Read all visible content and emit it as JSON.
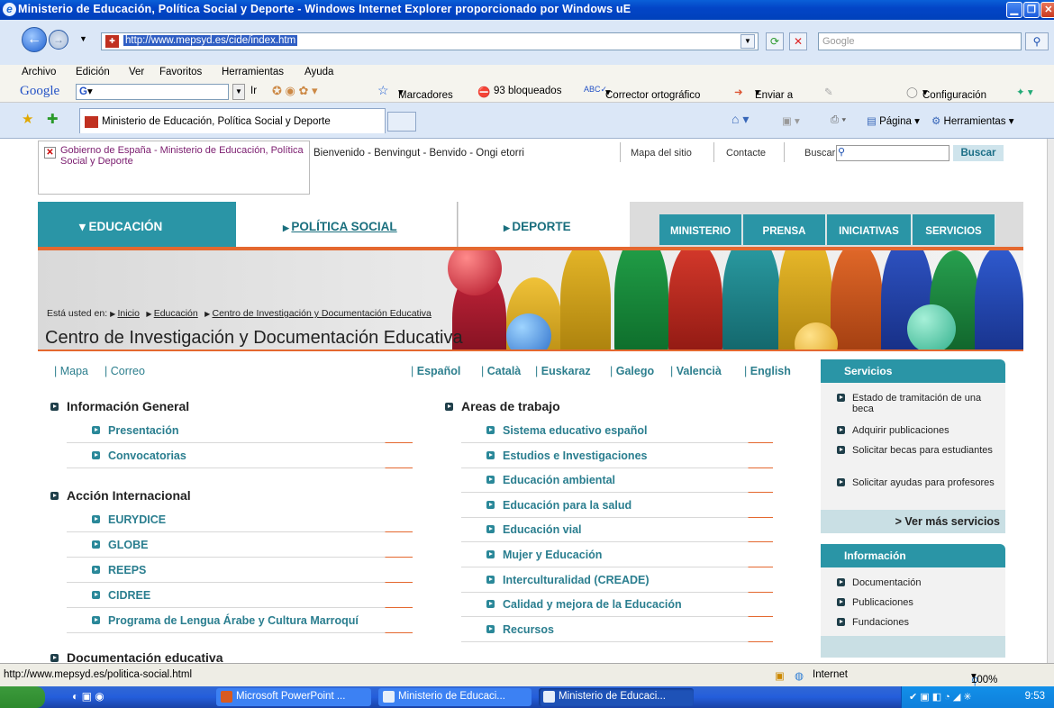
{
  "window": {
    "title": "Ministerio de Educación, Política Social y Deporte - Windows Internet Explorer proporcionado por Windows uE"
  },
  "addressbar": {
    "url": "http://www.mepsyd.es/cide/index.htm",
    "search_placeholder": "Google"
  },
  "menubar": [
    "Archivo",
    "Edición",
    "Ver",
    "Favoritos",
    "Herramientas",
    "Ayuda"
  ],
  "google_toolbar": {
    "brand": "Google",
    "g_field": "G",
    "ir": "Ir",
    "marcadores": "Marcadores",
    "bloqueados": "93 bloqueados",
    "corrector": "Corrector ortográfico",
    "enviar": "Enviar a",
    "configuracion": "Configuración"
  },
  "tabs": {
    "active_tab": "Ministerio de Educación, Política Social y Deporte",
    "pagina": "Página",
    "herramientas": "Herramientas"
  },
  "page": {
    "gov_logo_text": "Gobierno de España - Ministerio de Educación, Política Social y Deporte",
    "welcome": "Bienvenido - Benvingut - Benvido - Ongi etorri",
    "mapa_sitio": "Mapa del sitio",
    "contacte": "Contacte",
    "buscar_label": "Buscar:",
    "buscar_button": "Buscar",
    "nav_main": [
      "EDUCACIÓN",
      "POLÍTICA SOCIAL",
      "DEPORTE"
    ],
    "nav_small": [
      "MINISTERIO",
      "PRENSA",
      "INICIATIVAS",
      "SERVICIOS"
    ],
    "breadcrumb": {
      "prefix": "Está usted en:",
      "items": [
        "Inicio",
        "Educación",
        "Centro de Investigación y Documentación Educativa"
      ]
    },
    "title": "Centro de Investigación y Documentación Educativa",
    "left_links": [
      "Mapa",
      "Correo"
    ],
    "languages": [
      "Español",
      "Català",
      "Euskaraz",
      "Galego",
      "Valencià",
      "English"
    ],
    "info_general": {
      "heading": "Información General",
      "items": [
        "Presentación",
        "Convocatorias"
      ]
    },
    "accion_internacional": {
      "heading": "Acción Internacional",
      "items": [
        "EURYDICE",
        "GLOBE",
        "REEPS",
        "CIDREE",
        "Programa de Lengua Árabe y Cultura Marroquí"
      ]
    },
    "documentacion_heading": "Documentación educativa",
    "areas": {
      "heading": "Areas de trabajo",
      "items": [
        "Sistema educativo español",
        "Estudios e Investigaciones",
        "Educación ambiental",
        "Educación para la salud",
        "Educación vial",
        "Mujer y Educación",
        "Interculturalidad (CREADE)",
        "Calidad y mejora de la Educación",
        "Recursos"
      ]
    },
    "servicios": {
      "heading": "Servicios",
      "items": [
        "Estado de tramitación de una beca",
        "Adquirir publicaciones",
        "Solicitar becas para estudiantes",
        "Solicitar ayudas para profesores"
      ],
      "more": "> Ver más servicios"
    },
    "informacion": {
      "heading": "Información",
      "items": [
        "Documentación",
        "Publicaciones",
        "Fundaciones"
      ]
    }
  },
  "statusbar": {
    "url": "http://www.mepsyd.es/politica-social.html",
    "zone": "Internet",
    "zoom": "100%"
  },
  "taskbar": {
    "tasks": [
      "Microsoft PowerPoint ...",
      "Ministerio de Educaci...",
      "Ministerio de Educaci..."
    ],
    "clock": "9:53"
  }
}
